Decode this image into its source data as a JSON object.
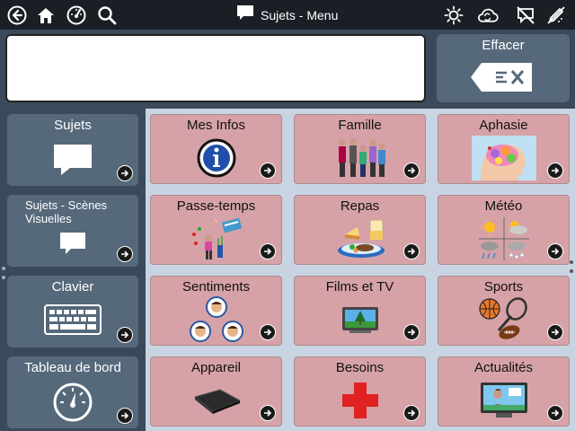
{
  "header": {
    "title": "Sujets - Menu",
    "left_icons": [
      "back-icon",
      "home-icon",
      "dashboard-icon",
      "search-icon"
    ],
    "right_icons": [
      "brightness-icon",
      "sync-icon",
      "speech-off-icon",
      "edit-icon"
    ]
  },
  "message": {
    "text": "",
    "clear_label": "Effacer"
  },
  "left": {
    "items": [
      {
        "label": "Sujets",
        "icon": "speech-bubble-icon"
      },
      {
        "label": "Sujets - Scènes Visuelles",
        "icon": "speech-bubble-small-icon"
      },
      {
        "label": "Clavier",
        "icon": "keyboard-icon"
      },
      {
        "label": "Tableau de bord",
        "icon": "gauge-icon"
      }
    ]
  },
  "grid": {
    "tiles": [
      {
        "label": "Mes Infos",
        "icon": "info-icon"
      },
      {
        "label": "Famille",
        "icon": "family-icon"
      },
      {
        "label": "Aphasie",
        "icon": "brain-icon"
      },
      {
        "label": "Passe-temps",
        "icon": "hobbies-icon"
      },
      {
        "label": "Repas",
        "icon": "meal-icon"
      },
      {
        "label": "Météo",
        "icon": "weather-icon"
      },
      {
        "label": "Sentiments",
        "icon": "faces-icon"
      },
      {
        "label": "Films et TV",
        "icon": "tv-icon"
      },
      {
        "label": "Sports",
        "icon": "sports-balls-icon"
      },
      {
        "label": "Appareil",
        "icon": "tablet-device-icon"
      },
      {
        "label": "Besoins",
        "icon": "red-cross-icon"
      },
      {
        "label": "Actualités",
        "icon": "news-tv-icon"
      }
    ]
  },
  "colors": {
    "topbar": "#1a1f26",
    "panel": "#3a4a5a",
    "left_tile": "#56697b",
    "grid_bg": "#c9d4e2",
    "tile": "#d6a2a8"
  }
}
